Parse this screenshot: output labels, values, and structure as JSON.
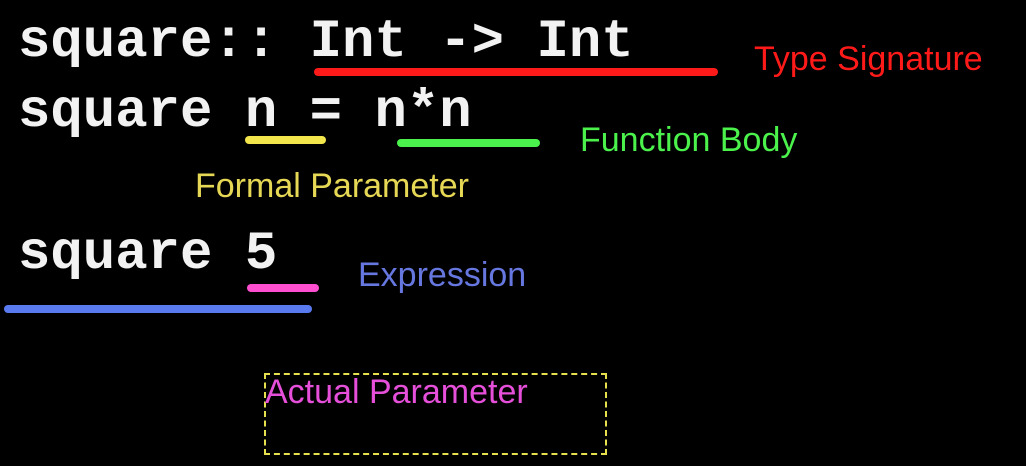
{
  "code_lines": {
    "type_signature_line": "square:: Int -> Int",
    "definition_line": "square n = n*n",
    "expression_line": "square 5"
  },
  "annotations": {
    "type_signature": {
      "text": "Type Signature",
      "color": "#ff1a1a"
    },
    "function_body": {
      "text": "Function Body",
      "color": "#4cf24c"
    },
    "formal_parameter": {
      "text": "Formal Parameter",
      "color": "#e6d855"
    },
    "expression": {
      "text": "Expression",
      "color": "#6677e0"
    },
    "actual_parameter": {
      "text": "Actual Parameter",
      "color": "#e64fd9"
    }
  },
  "colors": {
    "background": "#000000",
    "code_text": "#f2f2f2",
    "dashed_box": "#e6e04f",
    "underline_type_signature": "#ff1a1a",
    "underline_formal_parameter": "#f2e64c",
    "underline_function_body": "#4cf24c",
    "underline_actual_parameter": "#ff4fd0",
    "underline_expression": "#5a7af0"
  }
}
